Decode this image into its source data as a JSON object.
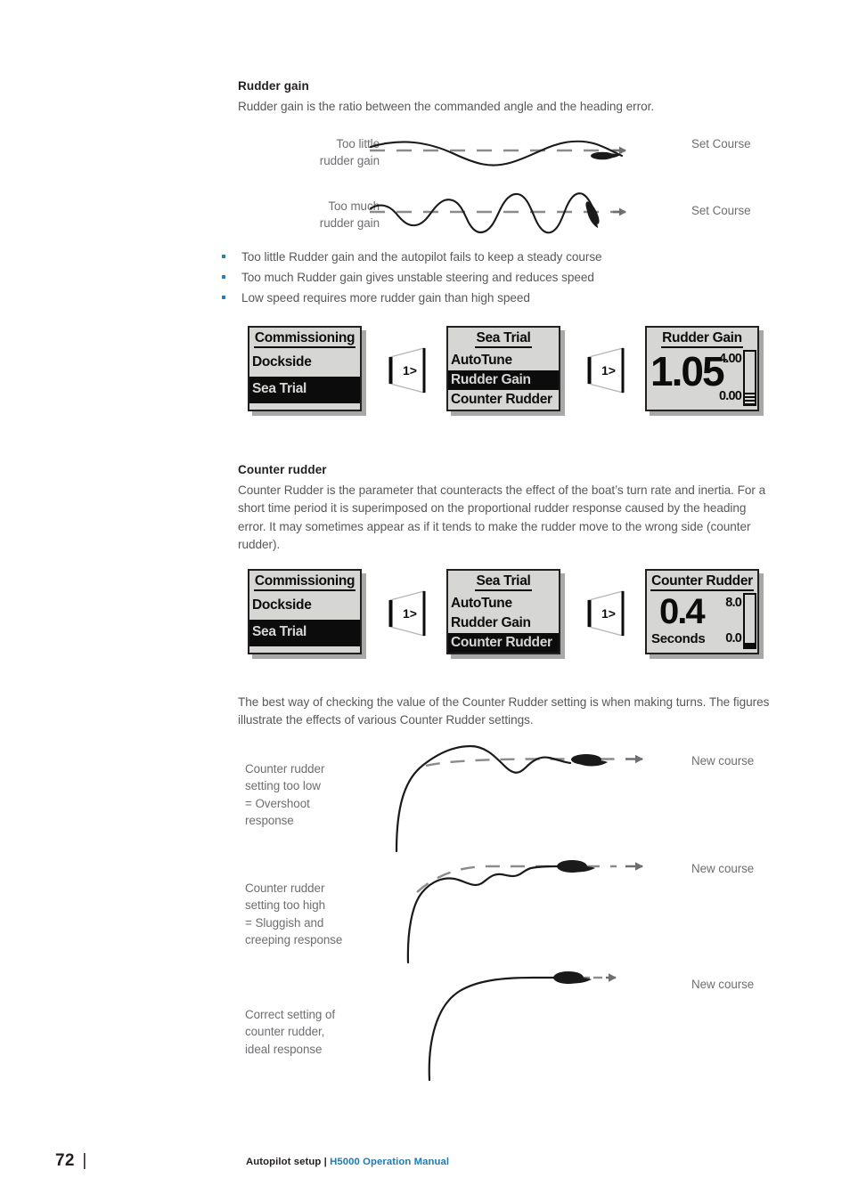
{
  "sections": {
    "rudder_gain": {
      "heading": "Rudder gain",
      "intro": "Rudder gain is the ratio between the commanded angle and the heading error.",
      "diagrams": [
        {
          "label": "Too little\nrudder gain",
          "right_label": "Set Course",
          "kind": "too-little"
        },
        {
          "label": "Too much\nrudder gain",
          "right_label": "Set Course",
          "kind": "too-much"
        }
      ],
      "bullets": [
        "Too little Rudder gain and the autopilot fails to keep a steady course",
        "Too much Rudder gain gives unstable steering and reduces speed",
        "Low speed requires more rudder gain than high speed"
      ]
    },
    "counter_rudder": {
      "heading": "Counter rudder",
      "intro": "Counter Rudder is the parameter that counteracts the effect of the boat’s turn rate and inertia. For a short time period it is superimposed on the proportional rudder response caused by the heading error. It may sometimes appear as if it tends to make the rudder move to the wrong side (counter rudder).",
      "outro": "The best way of checking the value of the Counter Rudder setting is when making turns. The figures illustrate the effects of various Counter Rudder settings.",
      "turn_diagrams": [
        {
          "label": "Counter rudder\nsetting too low\n= Overshoot\nresponse",
          "right_label": "New course"
        },
        {
          "label": "Counter rudder\nsetting too high\n= Sluggish and\ncreeping response",
          "right_label": "New course"
        },
        {
          "label": "Correct setting of\ncounter rudder,\nideal response",
          "right_label": "New course"
        }
      ]
    }
  },
  "screen_flow_rudder_gain": {
    "key_label_1": "1>",
    "key_label_2": "1>",
    "screen1": {
      "title": "Commissioning",
      "rows": [
        {
          "label": "Dockside",
          "selected": false
        },
        {
          "label": "Sea Trial",
          "selected": true
        }
      ]
    },
    "screen2": {
      "title": "Sea Trial",
      "rows": [
        {
          "label": "AutoTune",
          "selected": false
        },
        {
          "label": "Rudder Gain",
          "selected": true
        },
        {
          "label": "Counter Rudder",
          "selected": false
        }
      ]
    },
    "screen3": {
      "title": "Rudder Gain",
      "value": "1.05",
      "degree_mark": "°",
      "scale_max": "4.00",
      "scale_min": "0.00",
      "bar_fill_percent": 22,
      "unit": ""
    }
  },
  "screen_flow_counter_rudder": {
    "key_label_1": "1>",
    "key_label_2": "1>",
    "screen1": {
      "title": "Commissioning",
      "rows": [
        {
          "label": "Dockside",
          "selected": false
        },
        {
          "label": "Sea Trial",
          "selected": true
        }
      ]
    },
    "screen2": {
      "title": "Sea Trial",
      "rows": [
        {
          "label": "AutoTune",
          "selected": false
        },
        {
          "label": "Rudder Gain",
          "selected": false
        },
        {
          "label": "Counter Rudder",
          "selected": true
        }
      ]
    },
    "screen3": {
      "title": "Counter Rudder",
      "value": "0.4",
      "unit": "Seconds",
      "scale_max": "8.0",
      "scale_min": "0.0",
      "bar_fill_percent": 8
    }
  },
  "footer": {
    "page_number": "72",
    "separator": "|",
    "left_text": "Autopilot setup",
    "mid_separator": " | ",
    "right_text": "H5000 Operation Manual"
  },
  "colors": {
    "bullet": "#2a7fb5",
    "link": "#1c7ab5",
    "body": "#58585b",
    "heading": "#231f20",
    "lcd_bg": "#d6d6d4",
    "lcd_ink": "#0c0c0c"
  }
}
